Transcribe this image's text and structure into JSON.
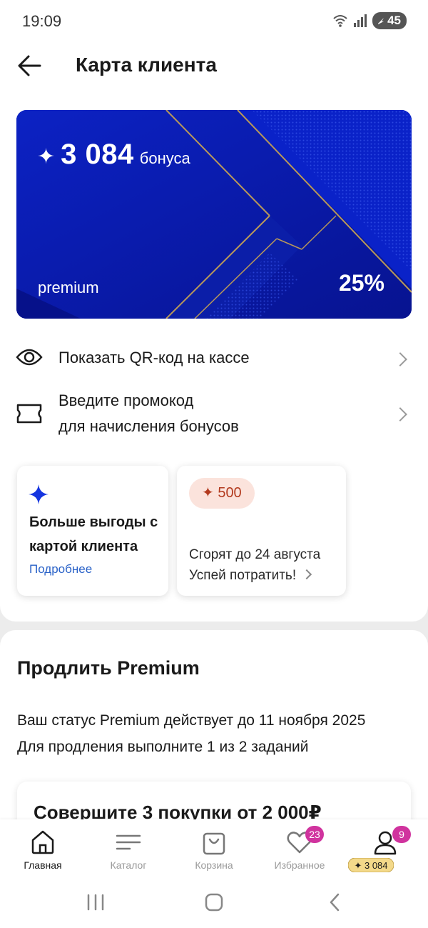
{
  "status_bar": {
    "time": "19:09",
    "battery": "45",
    "icons": [
      "wifi-icon",
      "signal-icon",
      "battery-icon"
    ]
  },
  "header": {
    "title": "Карта клиента",
    "back_icon": "arrow-left-icon"
  },
  "card": {
    "bonus_amount": "3 084",
    "bonus_unit": "бонуса",
    "star": "✦",
    "tier": "premium",
    "discount": "25%",
    "colors": {
      "background": "#0a1cb0",
      "accent_lines": "#b8985a"
    }
  },
  "menu": [
    {
      "label": "Показать QR-код на кассе",
      "icon": "eye-icon"
    },
    {
      "label_line1": "Введите промокод",
      "label_line2": "для начисления бонусов",
      "icon": "ticket-icon"
    }
  ],
  "promos": {
    "left": {
      "title": "Больше выгоды с картой клиента",
      "link": "Подробнее",
      "icon": "sparkle-icon"
    },
    "right": {
      "pill": "✦ 500",
      "line1": "Сгорят до 24 августа",
      "line2": "Успей потратить!"
    }
  },
  "premium": {
    "title": "Продлить Premium",
    "line1": "Ваш статус Premium действует до 11 ноября 2025",
    "line2": "Для продления выполните 1 из 2 заданий",
    "task_title": "Совершите 3 покупки от 2 000₽"
  },
  "tabs": [
    {
      "label": "Главная",
      "icon": "home-icon",
      "active": true
    },
    {
      "label": "Каталог",
      "icon": "menu-icon"
    },
    {
      "label": "Корзина",
      "icon": "bag-icon"
    },
    {
      "label": "Избранное",
      "icon": "heart-icon",
      "badge": "23"
    },
    {
      "label": "✦ 3 084",
      "icon": "profile-icon",
      "badge": "9"
    }
  ],
  "colors": {
    "badge": "#d0339e",
    "link": "#2a62c8",
    "pill_bg": "#fbe3dc",
    "pill_text": "#b33a1e",
    "bonus_chip": "#f3d98a"
  }
}
